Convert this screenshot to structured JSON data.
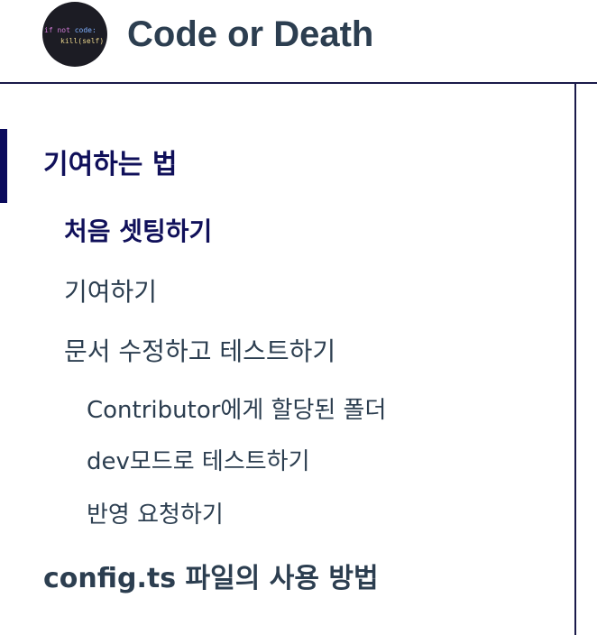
{
  "header": {
    "logo": {
      "line1_kw": "if not",
      "line1_rest": " code:",
      "line2": "kill(self)"
    },
    "title": "Code or Death"
  },
  "sidebar": {
    "section_title": "기여하는 법",
    "items": [
      {
        "label": "처음 셋팅하기"
      },
      {
        "label": "기여하기"
      },
      {
        "label": "문서 수정하고 테스트하기"
      }
    ],
    "subitems": [
      {
        "label": "Contributor에게 할당된 폴더"
      },
      {
        "label": "dev모드로 테스트하기"
      },
      {
        "label": "반영 요청하기"
      }
    ],
    "next_section_title": "config.ts 파일의 사용 방법"
  },
  "colors": {
    "accent": "#10105a",
    "text": "#2c3e50",
    "divider": "#1a1a4a"
  }
}
